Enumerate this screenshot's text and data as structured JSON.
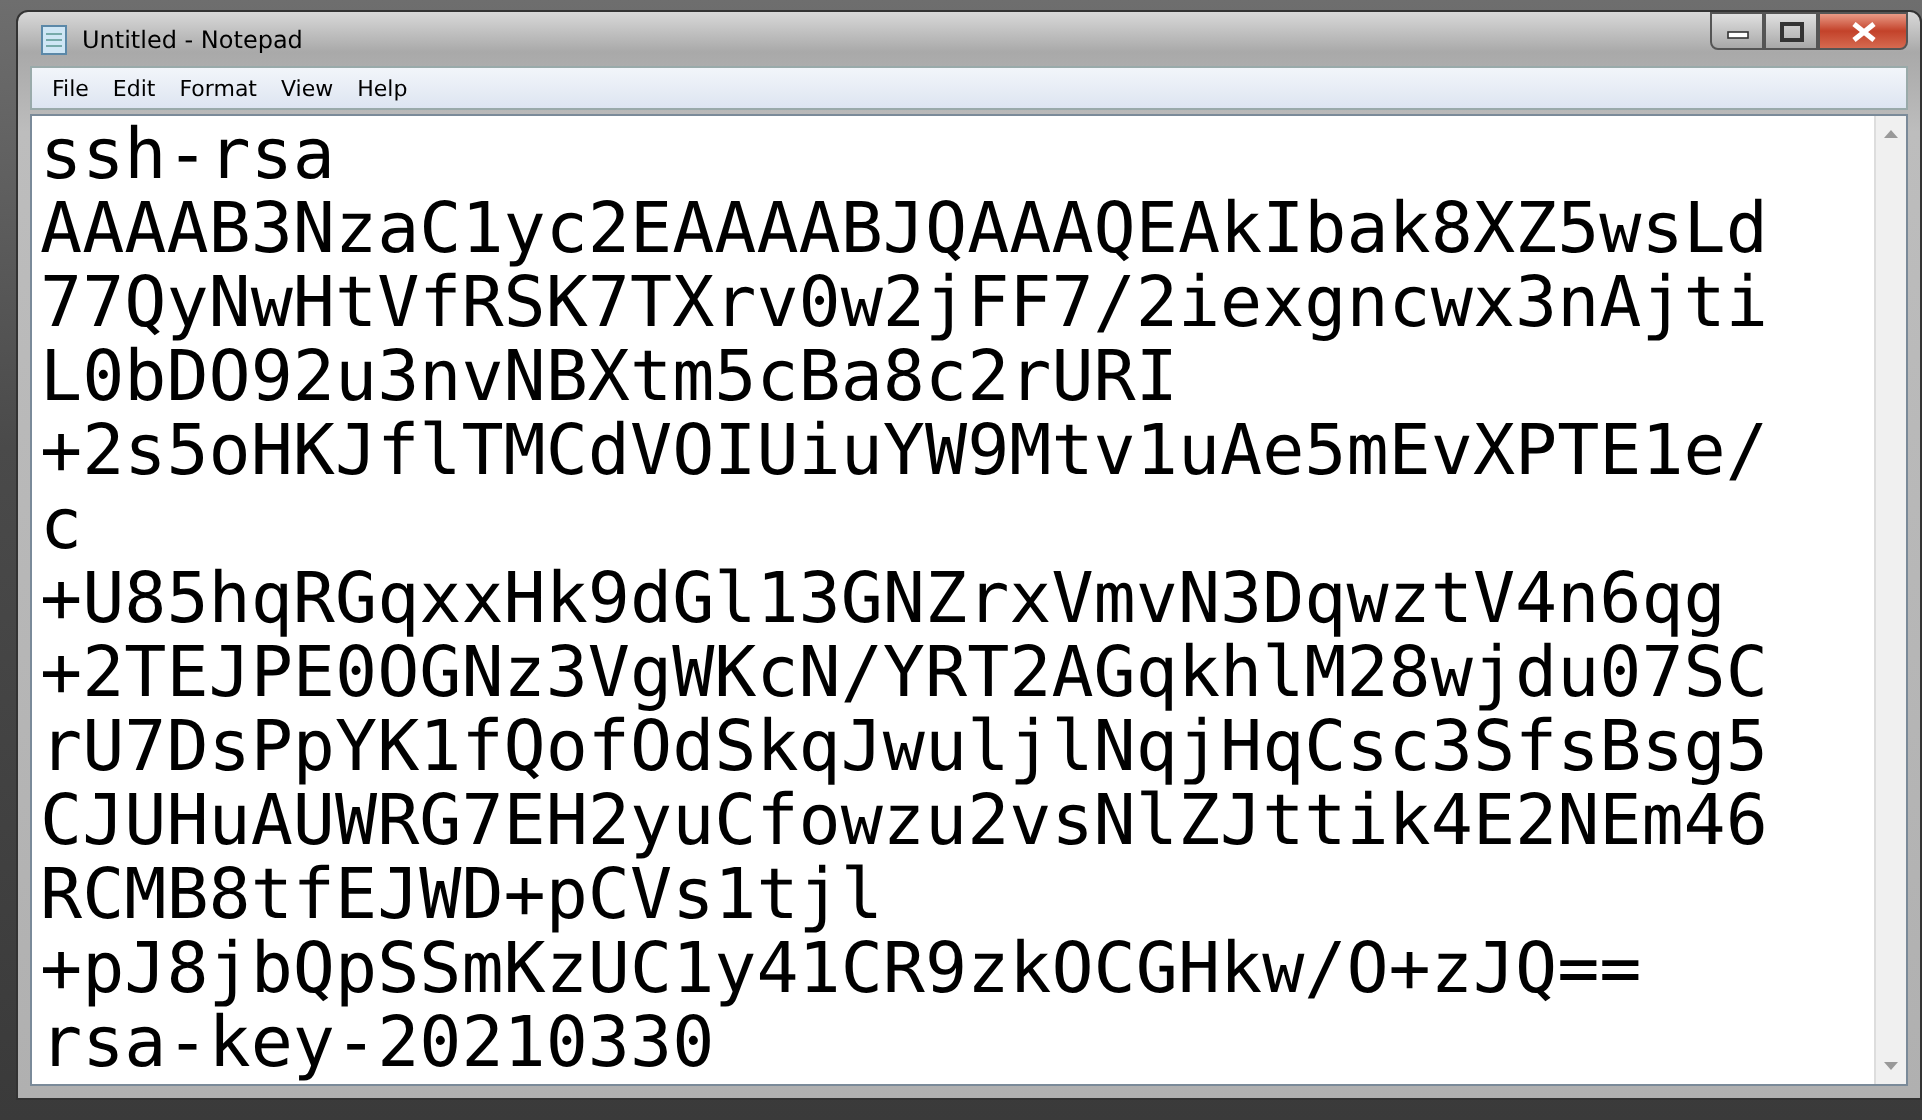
{
  "window": {
    "title": "Untitled - Notepad"
  },
  "menu": [
    "File",
    "Edit",
    "Format",
    "View",
    "Help"
  ],
  "editor": {
    "lines": [
      "ssh-rsa",
      "AAAAB3NzaC1yc2EAAAABJQAAAQEAkIbak8XZ5wsLd",
      "77QyNwHtVfRSK7TXrv0w2jFF7/2iexgncwx3nAjti",
      "L0bDO92u3nvNBXtm5cBa8c2rURI",
      "+2s5oHKJflTMCdVOIUiuYW9Mtv1uAe5mEvXPTE1e/",
      "c",
      "+U85hqRGqxxHk9dGl13GNZrxVmvN3DqwztV4n6qg",
      "+2TEJPE0OGNz3VgWKcN/YRT2AGqkhlM28wjdu07SC",
      "rU7DsPpYK1fQofOdSkqJwuljlNqjHqCsc3SfsBsg5",
      "CJUHuAUWRG7EH2yuCfowzu2vsNlZJttik4E2NEm46",
      "RCMB8tfEJWD+pCVs1tjl",
      "+pJ8jbQpSSmKzUC1y41CR9zkOCGHkw/O+zJQ==",
      "rsa-key-20210330"
    ]
  }
}
